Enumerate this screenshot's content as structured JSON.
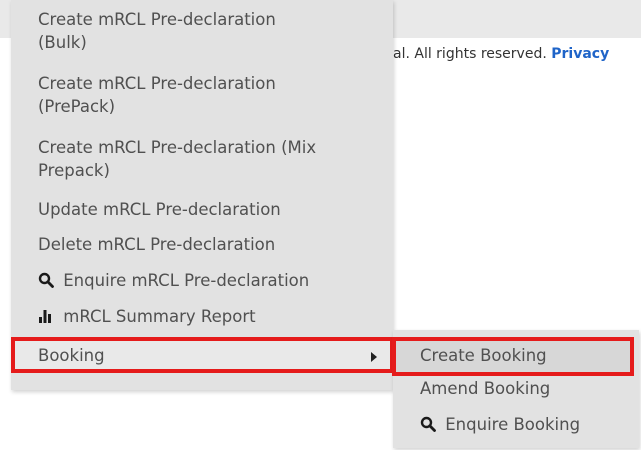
{
  "footer": {
    "text": "al. All rights reserved.",
    "privacy_link": "Privacy"
  },
  "menu": {
    "items": [
      {
        "label_line1": "Create mRCL Pre-declaration",
        "label_line2": "(Bulk)"
      },
      {
        "label_line1": "Create mRCL Pre-declaration",
        "label_line2": "(PrePack)"
      },
      {
        "label_line1": "Create mRCL Pre-declaration (Mix",
        "label_line2": "Prepack)"
      },
      {
        "label": "Update mRCL Pre-declaration"
      },
      {
        "label": "Delete mRCL Pre-declaration"
      },
      {
        "label": "Enquire mRCL Pre-declaration",
        "icon": "search-icon"
      },
      {
        "label": "mRCL Summary Report",
        "icon": "bar-chart-icon"
      },
      {
        "label": "Booking",
        "icon": "caret-right-icon"
      }
    ]
  },
  "submenu": {
    "items": [
      {
        "label": "Create Booking"
      },
      {
        "label": "Amend Booking"
      },
      {
        "label": "Enquire Booking",
        "icon": "search-icon"
      }
    ]
  },
  "colors": {
    "highlight_border": "#e51b1b",
    "menu_bg": "#e2e2e2",
    "link": "#1f64c8"
  }
}
